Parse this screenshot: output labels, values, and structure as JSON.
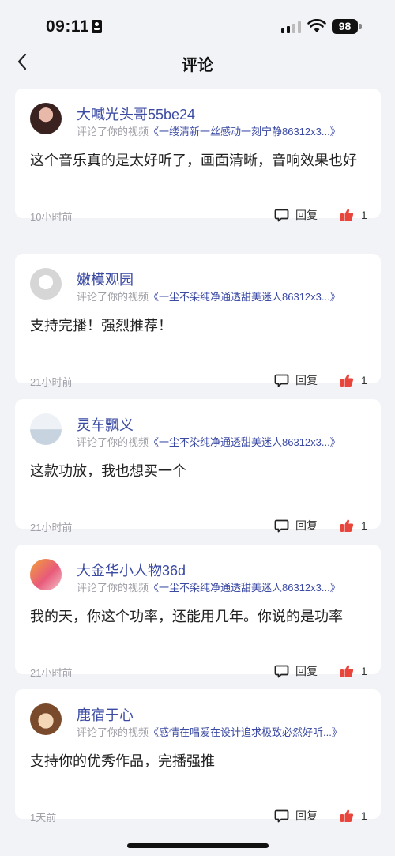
{
  "status_bar": {
    "time": "09:11",
    "battery": "98"
  },
  "header": {
    "title": "评论"
  },
  "comments": [
    {
      "username": "大喊光头哥55be24",
      "prefix": "评论了你的视频",
      "video_title": "《一缕清新一丝感动一刻宁静86312x3...》",
      "text": "这个音乐真的是太好听了，画面清晰，音响效果也好",
      "time": "10小时前",
      "reply_label": "回复",
      "likes": "1"
    },
    {
      "username": "嫩模观园",
      "prefix": "评论了你的视频",
      "video_title": "《一尘不染纯净通透甜美迷人86312x3...》",
      "text": "支持完播！强烈推荐！",
      "time": "21小时前",
      "reply_label": "回复",
      "likes": "1"
    },
    {
      "username": "灵车飘义",
      "prefix": "评论了你的视频",
      "video_title": "《一尘不染纯净通透甜美迷人86312x3...》",
      "text": "这款功放，我也想买一个",
      "time": "21小时前",
      "reply_label": "回复",
      "likes": "1"
    },
    {
      "username": "大金华小人物36d",
      "prefix": "评论了你的视频",
      "video_title": "《一尘不染纯净通透甜美迷人86312x3...》",
      "text": "我的天，你这个功率，还能用几年。你说的是功率",
      "time": "21小时前",
      "reply_label": "回复",
      "likes": "1"
    },
    {
      "username": "鹿宿于心",
      "prefix": "评论了你的视频",
      "video_title": "《感情在唱爱在设计追求极致必然好听...》",
      "text": "支持你的优秀作品，完播强推",
      "time": "1天前",
      "reply_label": "回复",
      "likes": "1"
    }
  ],
  "colors": {
    "accent": "#3b4aa3",
    "like": "#e8453c",
    "background": "#f2f3f7"
  },
  "icons": [
    "back-arrow-icon",
    "comment-bubble-icon",
    "thumbs-up-icon",
    "signal-icon",
    "wifi-icon",
    "battery-icon",
    "id-card-icon"
  ]
}
